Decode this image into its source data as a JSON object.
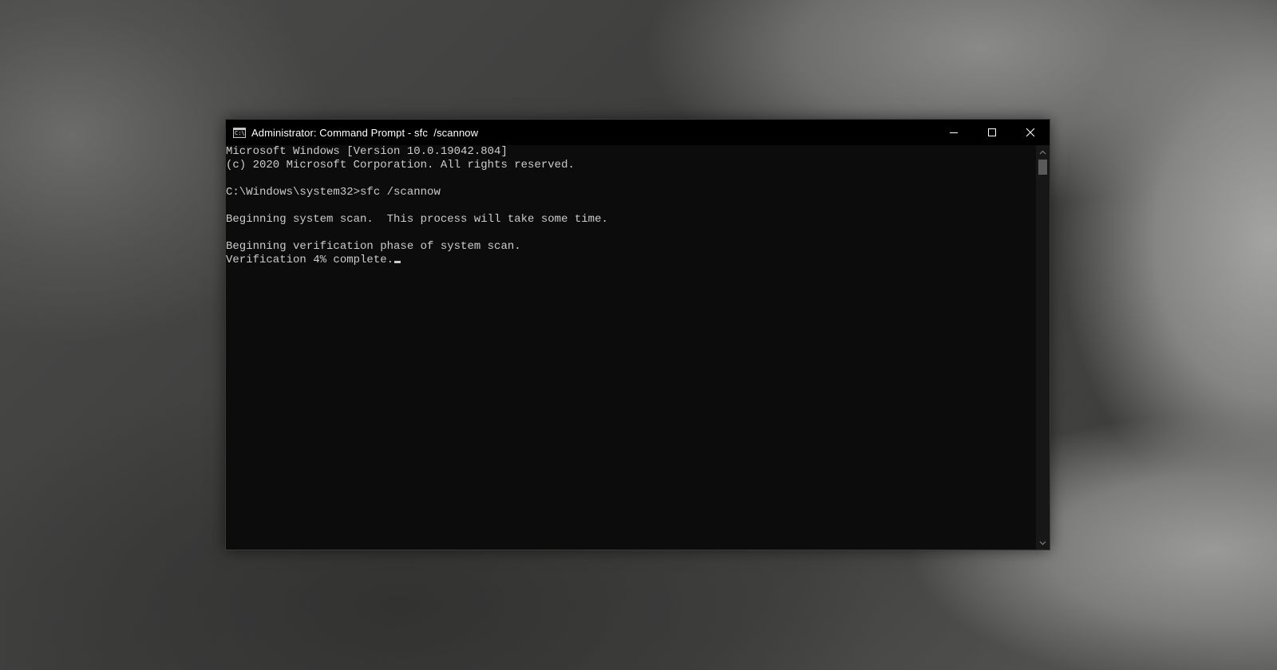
{
  "window": {
    "title": "Administrator: Command Prompt - sfc  /scannow",
    "app_icon_text": "C:\\"
  },
  "console": {
    "lines": [
      "Microsoft Windows [Version 10.0.19042.804]",
      "(c) 2020 Microsoft Corporation. All rights reserved.",
      "",
      "C:\\Windows\\system32>sfc /scannow",
      "",
      "Beginning system scan.  This process will take some time.",
      "",
      "Beginning verification phase of system scan.",
      "Verification 4% complete."
    ]
  },
  "icons": {
    "minimize": "minimize-icon",
    "maximize": "maximize-icon",
    "close": "close-icon",
    "scroll_up": "chevron-up-icon",
    "scroll_down": "chevron-down-icon"
  },
  "colors": {
    "console_bg": "#0c0c0c",
    "console_text": "#cccccc",
    "titlebar_bg": "#000000"
  }
}
